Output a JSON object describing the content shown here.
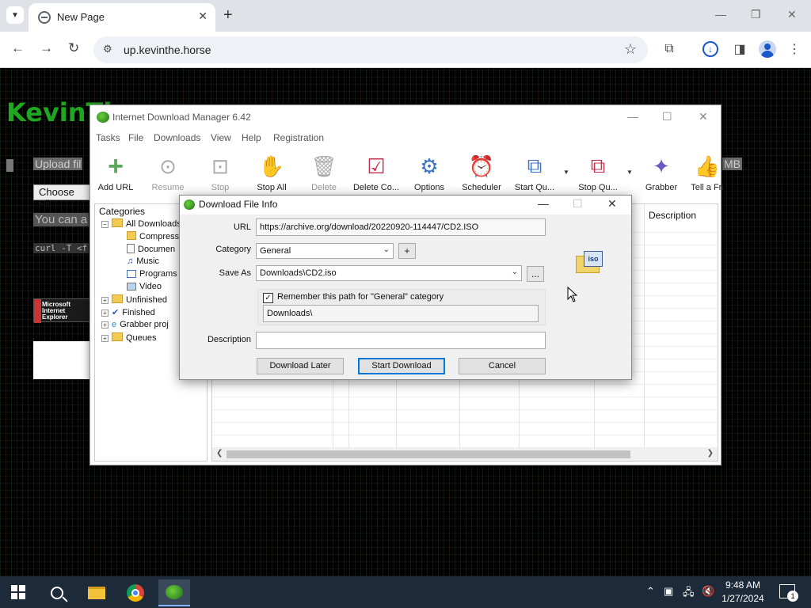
{
  "browser": {
    "tab_title": "New Page",
    "url": "up.kevinthe.horse",
    "win_minimize": "—",
    "win_restore": "❐",
    "win_close": "✕"
  },
  "page": {
    "title": "KevinTh",
    "upload_text": "Upload fil",
    "choose_file": "Choose Fil",
    "can_text": "You can a",
    "curl_text": "curl -T <f",
    "size_text": "MB",
    "ie_badge": "Microsoft Internet Explorer"
  },
  "idm": {
    "title": "Internet Download Manager 6.42",
    "menu": [
      "Tasks",
      "File",
      "Downloads",
      "View",
      "Help",
      "Registration"
    ],
    "toolbar": [
      {
        "label": "Add URL",
        "icon": "plus-icon",
        "enabled": true
      },
      {
        "label": "Resume",
        "icon": "resume-icon",
        "enabled": false
      },
      {
        "label": "Stop",
        "icon": "stop-icon",
        "enabled": false
      },
      {
        "label": "Stop All",
        "icon": "hand-icon",
        "enabled": true
      },
      {
        "label": "Delete",
        "icon": "trash-icon",
        "enabled": false
      },
      {
        "label": "Delete Co...",
        "icon": "delete-completed-icon",
        "enabled": true
      },
      {
        "label": "Options",
        "icon": "gear-icon",
        "enabled": true
      },
      {
        "label": "Scheduler",
        "icon": "clock-icon",
        "enabled": true
      },
      {
        "label": "Start Qu...",
        "icon": "start-queue-icon",
        "enabled": true
      },
      {
        "label": "Stop Qu...",
        "icon": "stop-queue-icon",
        "enabled": true
      },
      {
        "label": "Grabber",
        "icon": "grabber-icon",
        "enabled": true
      },
      {
        "label": "Tell a Fri",
        "icon": "thumbs-up-icon",
        "enabled": true
      }
    ],
    "categories_header": "Categories",
    "categories": {
      "all": "All Downloads",
      "compressed": "Compress",
      "documents": "Documen",
      "music": "Music",
      "programs": "Programs",
      "video": "Video",
      "unfinished": "Unfinished",
      "finished": "Finished",
      "grabber": "Grabber proj",
      "queues": "Queues"
    },
    "list_description_header": "Description"
  },
  "dialog": {
    "title": "Download File Info",
    "url_label": "URL",
    "url_value": "https://archive.org/download/20220920-114447/CD2.ISO",
    "category_label": "Category",
    "category_value": "General",
    "add_category": "+",
    "save_as_label": "Save As",
    "save_as_value": "Downloads\\CD2.iso",
    "browse": "...",
    "remember_label": "Remember this path for \"General\" category",
    "remember_checked": true,
    "path_value": "Downloads\\",
    "description_label": "Description",
    "description_value": "",
    "download_later": "Download Later",
    "start_download": "Start Download",
    "cancel": "Cancel",
    "file_type": "iso"
  },
  "taskbar": {
    "time": "9:48 AM",
    "date": "1/27/2024",
    "notifications": "1"
  }
}
